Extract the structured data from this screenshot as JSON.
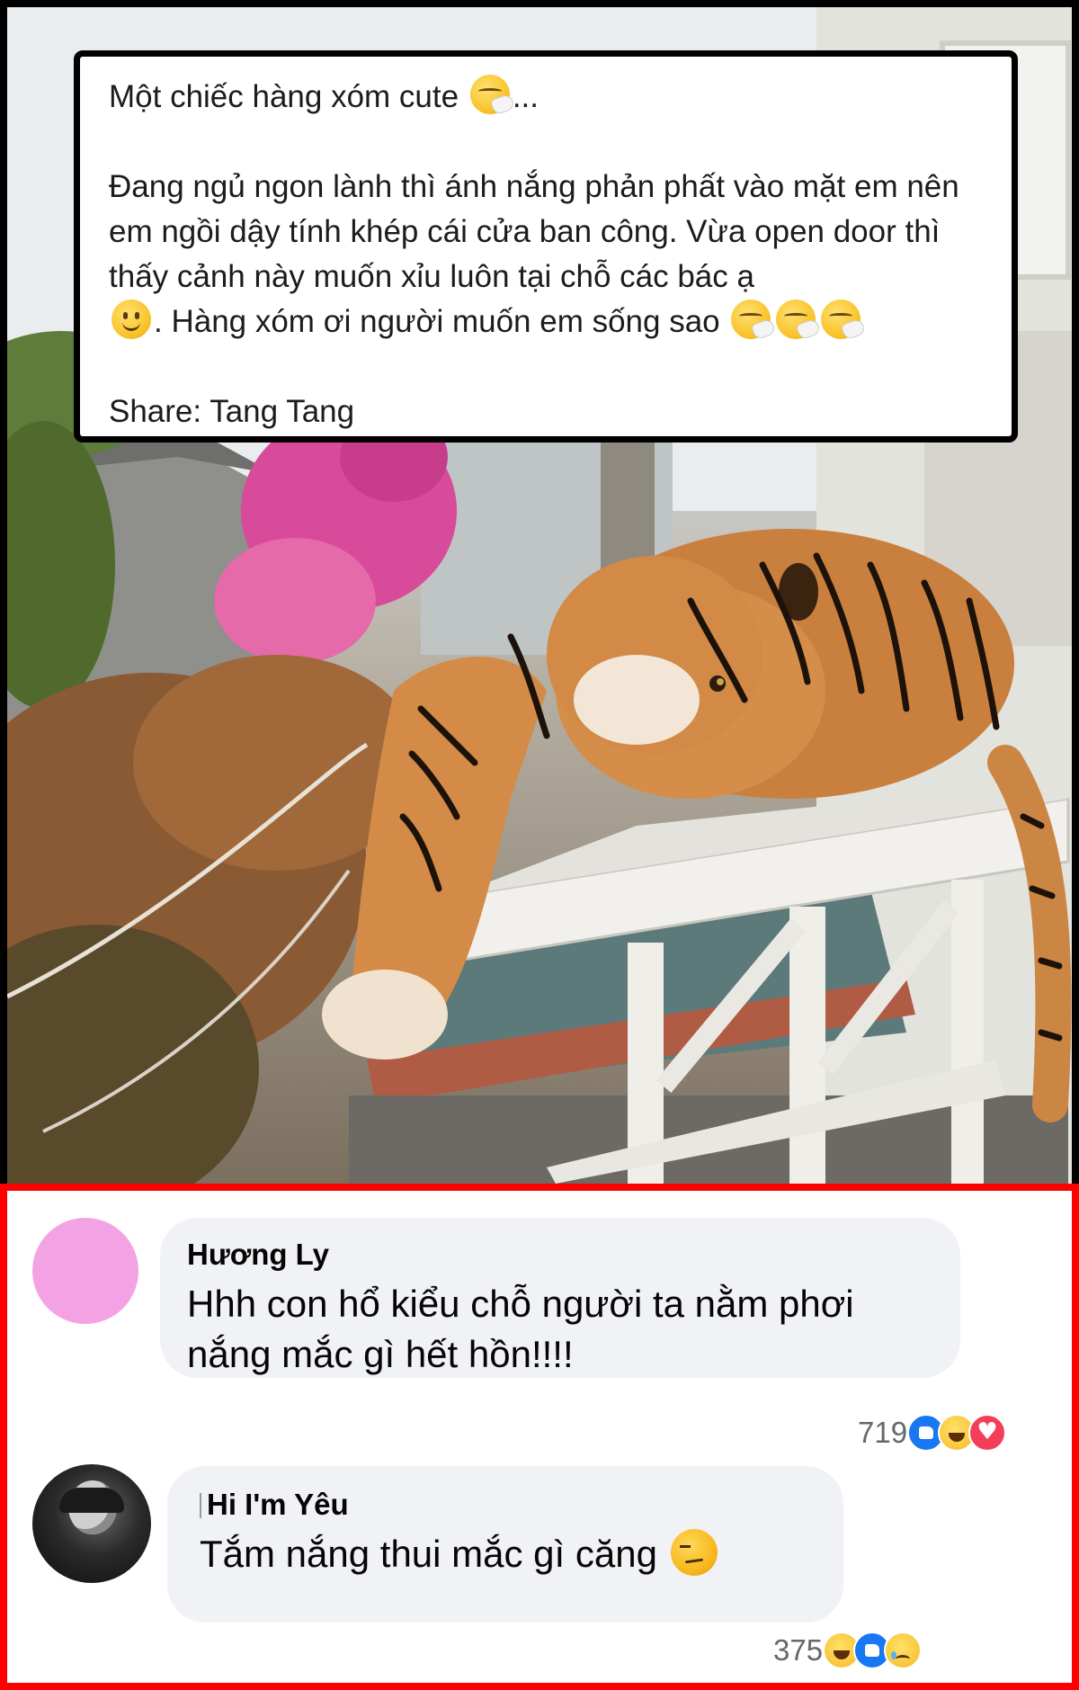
{
  "post": {
    "caption_line1": "Một chiếc hàng xóm cute",
    "caption_line1_suffix": "...",
    "caption_body_a": "Đang ngủ ngon lành thì ánh nắng phản phất vào mặt em nên em ngồi dậy tính khép cái cửa ban công. Vừa open door thì thấy cảnh này muốn xỉu luôn tại chỗ các bác ạ",
    "caption_body_b": ". Hàng xóm ơi người muốn em sống sao",
    "share": "Share: Tang Tang",
    "icons": [
      "sneezing-face-emoji",
      "slightly-smiling-face-emoji"
    ]
  },
  "comments": [
    {
      "author": "Hương Ly",
      "text": "Hhh con hổ kiểu chỗ người ta nằm phơi nắng mắc gì hết hồn!!!!",
      "reaction_count": "719",
      "reactions": [
        "like",
        "haha",
        "love"
      ]
    },
    {
      "author": "Hi I'm Yêu",
      "text": "Tắm nắng thui mắc gì căng",
      "reaction_count": "375",
      "reactions": [
        "haha",
        "like",
        "sad"
      ]
    }
  ],
  "colors": {
    "comment_frame": "#ff0000",
    "bubble_bg": "#f0f2f5",
    "like_blue": "#1877f2",
    "love_red": "#f33e58",
    "avatar_pink": "#f3a3e4"
  }
}
